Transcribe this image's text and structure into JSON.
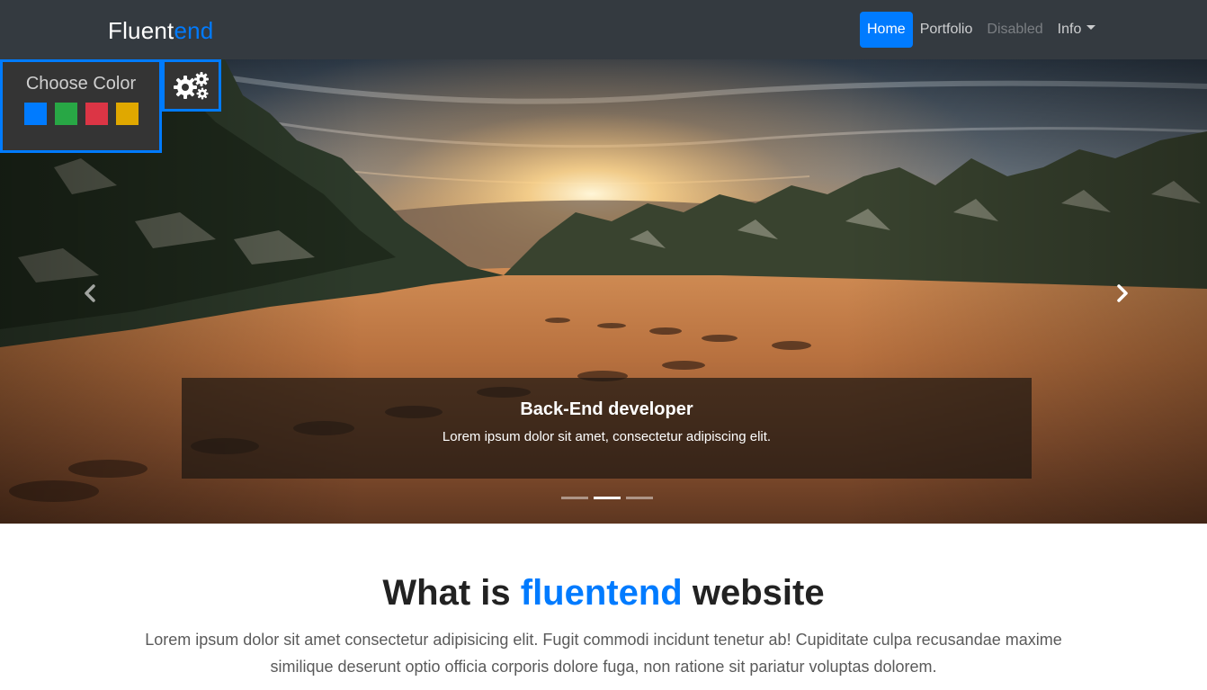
{
  "navbar": {
    "brand_prefix": "Fluent",
    "brand_accent": "end",
    "items": [
      {
        "label": "Home",
        "state": "active"
      },
      {
        "label": "Portfolio",
        "state": "normal"
      },
      {
        "label": "Disabled",
        "state": "disabled"
      },
      {
        "label": "Info",
        "state": "dropdown"
      }
    ]
  },
  "color_chooser": {
    "title": "Choose Color",
    "swatches": [
      "#007bff",
      "#28a745",
      "#dc3545",
      "#e0a800"
    ],
    "toggle_icon": "gears-icon"
  },
  "carousel": {
    "caption_title": "Back-End developer",
    "caption_text": "Lorem ipsum dolor sit amet, consectetur adipiscing elit.",
    "slide_count": 3,
    "active_slide": 2,
    "prev_icon": "chevron-left-icon",
    "next_icon": "chevron-right-icon"
  },
  "intro": {
    "heading_prefix": "What is ",
    "heading_accent": "fluentend",
    "heading_suffix": " website",
    "body": "Lorem ipsum dolor sit amet consectetur adipisicing elit. Fugit commodi incidunt tenetur ab! Cupiditate culpa recusandae maxime similique deserunt optio officia corporis dolore fuga, non ratione sit pariatur voluptas dolorem."
  },
  "colors": {
    "accent": "#007bff",
    "navbar_bg": "#343a40"
  }
}
